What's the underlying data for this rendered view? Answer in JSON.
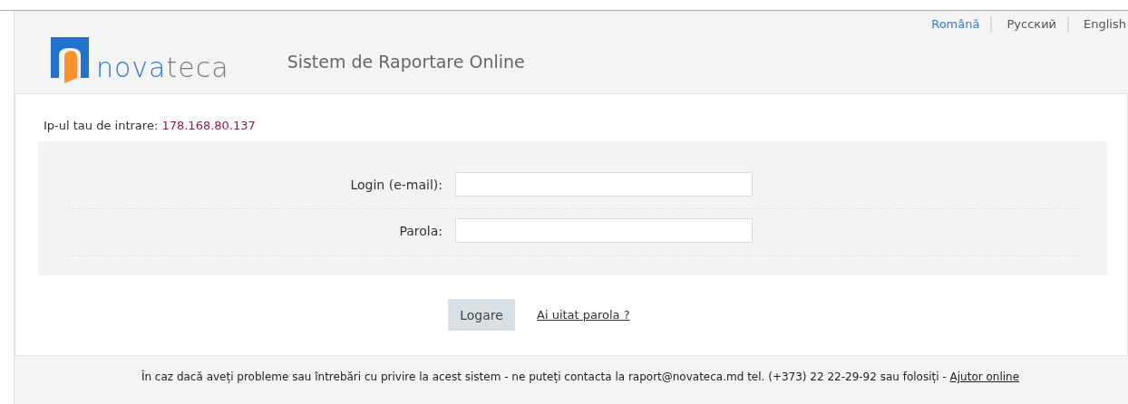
{
  "languages": [
    {
      "label": "Română",
      "selected": true
    },
    {
      "label": "Русский",
      "selected": false
    },
    {
      "label": "English",
      "selected": false
    }
  ],
  "logo": {
    "first": "nova",
    "second": "teca"
  },
  "app_title": "Sistem de Raportare Online",
  "ip": {
    "label": "Ip-ul tau de intrare:",
    "value": "178.168.80.137"
  },
  "fields": [
    {
      "label": "Login (e-mail):"
    },
    {
      "label": "Parola:"
    }
  ],
  "login_button": "Logare",
  "forgot_link": "Ai uitat parola ?",
  "footer": {
    "text": "În caz dacă aveți probleme sau întrebări cu privire la acest sistem - ne puteți contacta la raport@novateca.md tel. (+373) 22 22-29-92 sau folosiți -",
    "link": "Ajutor online"
  }
}
